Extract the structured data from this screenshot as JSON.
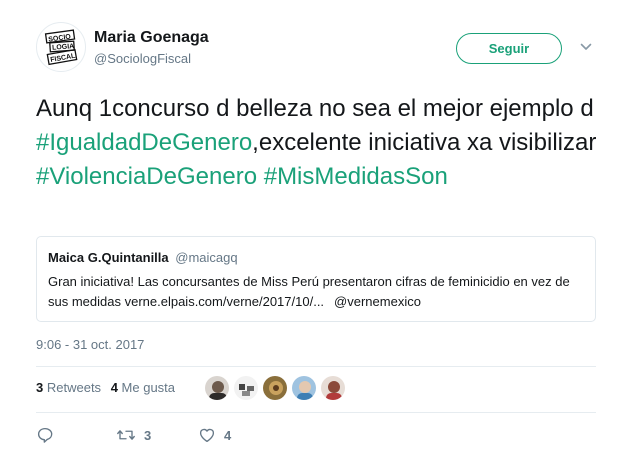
{
  "author": {
    "name": "Maria Goenaga",
    "handle": "@SociologFiscal",
    "avatar_logo_text": [
      "SOCIO",
      "LOGIA",
      "FISCAL"
    ]
  },
  "follow_button": {
    "label": "Seguir"
  },
  "menu": {
    "icon": "chevron-down-icon"
  },
  "tweet": {
    "segments": [
      {
        "type": "text",
        "value": "Aunq 1concurso d belleza no sea el mejor ejemplo d "
      },
      {
        "type": "hashtag",
        "value": "#IgualdadDeGenero"
      },
      {
        "type": "text",
        "value": ",excelente iniciativa xa visibilizar "
      },
      {
        "type": "hashtag",
        "value": "#ViolenciaDeGenero"
      },
      {
        "type": "text",
        "value": " "
      },
      {
        "type": "hashtag",
        "value": "#MisMedidasSon"
      }
    ]
  },
  "quoted_tweet": {
    "name": "Maica G.Quintanilla",
    "handle": "@maicagq",
    "body": "Gran iniciativa! Las concursantes de Miss Perú presentaron cifras de feminicidio en vez de sus medidas verne.elpais.com/verne/2017/10/...",
    "mention": "@vernemexico"
  },
  "timestamp": "9:06 - 31 oct. 2017",
  "stats": {
    "retweets_count": "3",
    "retweets_label": "Retweets",
    "likes_count": "4",
    "likes_label": "Me gusta"
  },
  "liker_avatars": [
    "avatar-1",
    "avatar-2",
    "avatar-3",
    "avatar-4",
    "avatar-5"
  ],
  "actions": {
    "reply": {
      "icon": "reply-icon"
    },
    "retweet": {
      "icon": "retweet-icon",
      "count": "3"
    },
    "like": {
      "icon": "heart-icon",
      "count": "4"
    }
  },
  "colors": {
    "accent": "#1aa179",
    "text": "#14171a",
    "muted": "#657786",
    "border": "#e1e8ed"
  }
}
